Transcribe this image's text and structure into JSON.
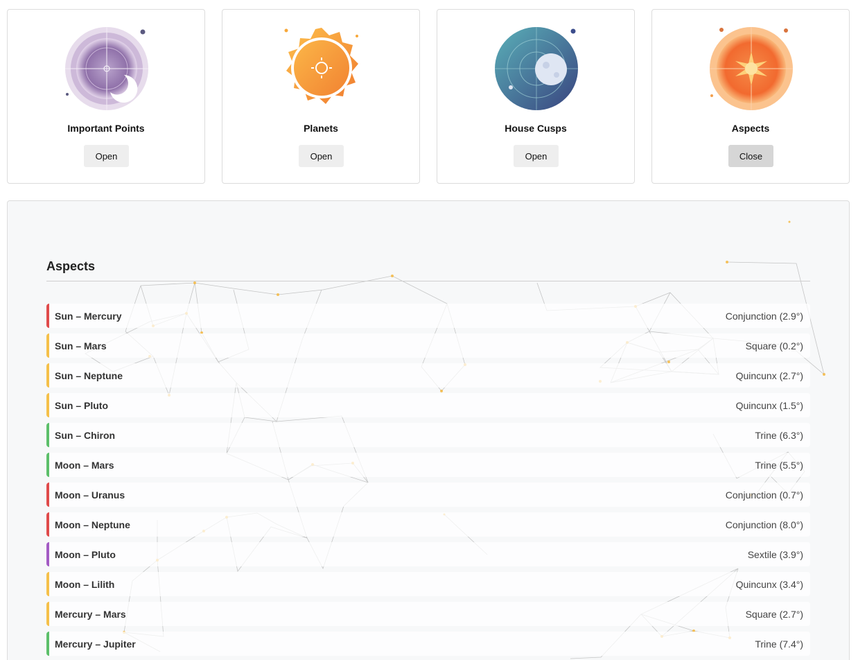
{
  "cards": [
    {
      "title": "Important Points",
      "button": "Open",
      "icon": "crescent-moon-wheel-icon"
    },
    {
      "title": "Planets",
      "button": "Open",
      "icon": "sun-badge-icon"
    },
    {
      "title": "House Cusps",
      "button": "Open",
      "icon": "moon-orbit-icon"
    },
    {
      "title": "Aspects",
      "button": "Close",
      "icon": "radiant-sun-icon"
    }
  ],
  "panel": {
    "title": "Aspects"
  },
  "colors": {
    "conjunction": "#e04b4b",
    "square": "#f5c04a",
    "quincunx": "#f5c04a",
    "trine": "#5cbf6a",
    "sextile": "#a35bc4"
  },
  "aspects": [
    {
      "pair": "Sun – Mercury",
      "aspect": "Conjunction (2.9°)",
      "kind": "conjunction"
    },
    {
      "pair": "Sun – Mars",
      "aspect": "Square (0.2°)",
      "kind": "square"
    },
    {
      "pair": "Sun – Neptune",
      "aspect": "Quincunx (2.7°)",
      "kind": "quincunx"
    },
    {
      "pair": "Sun – Pluto",
      "aspect": "Quincunx (1.5°)",
      "kind": "quincunx"
    },
    {
      "pair": "Sun – Chiron",
      "aspect": "Trine (6.3°)",
      "kind": "trine"
    },
    {
      "pair": "Moon – Mars",
      "aspect": "Trine (5.5°)",
      "kind": "trine"
    },
    {
      "pair": "Moon – Uranus",
      "aspect": "Conjunction (0.7°)",
      "kind": "conjunction"
    },
    {
      "pair": "Moon – Neptune",
      "aspect": "Conjunction (8.0°)",
      "kind": "conjunction"
    },
    {
      "pair": "Moon – Pluto",
      "aspect": "Sextile (3.9°)",
      "kind": "sextile"
    },
    {
      "pair": "Moon – Lilith",
      "aspect": "Quincunx (3.4°)",
      "kind": "quincunx"
    },
    {
      "pair": "Mercury – Mars",
      "aspect": "Square (2.7°)",
      "kind": "square"
    },
    {
      "pair": "Mercury – Jupiter",
      "aspect": "Trine (7.4°)",
      "kind": "trine"
    }
  ]
}
